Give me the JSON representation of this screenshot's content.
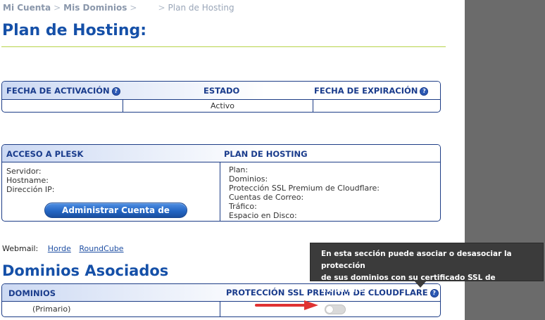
{
  "breadcrumb": {
    "item1": "Mi Cuenta",
    "item2": "Mis Dominios",
    "sep": ">",
    "current": "Plan de Hosting"
  },
  "page_title": "Plan de Hosting:",
  "status_table": {
    "headers": {
      "activation": "FECHA DE ACTIVACIÓN",
      "status": "ESTADO",
      "expiration": "FECHA DE EXPIRACIÓN"
    },
    "row": {
      "activation": "",
      "status": "Activo",
      "expiration": ""
    }
  },
  "plesk": {
    "header": "ACCESO A PLESK",
    "labels": [
      "Servidor:",
      "Hostname:",
      "Dirección IP:"
    ],
    "button": "Administrar Cuenta de Hosting"
  },
  "plan": {
    "header": "PLAN DE HOSTING",
    "labels": [
      "Plan:",
      "Dominios:",
      "Protección SSL Premium de Cloudflare:",
      "Cuentas de Correo:",
      "Tráfico:",
      "Espacio en Disco:"
    ]
  },
  "webmail": {
    "label": "Webmail:",
    "links": [
      "Horde",
      "RoundCube"
    ]
  },
  "domains_section": {
    "title": "Dominios Asociados",
    "headers": {
      "domains": "DOMINIOS",
      "ssl": "PROTECCIÓN SSL PREMIUM DE CLOUDFLARE"
    },
    "rows": [
      {
        "domain": "(Primario)",
        "ssl_enabled": false
      }
    ]
  },
  "tooltip": {
    "line1": "En esta sección puede asociar o desasociar la protección",
    "line2": "de sus dominios con su certificado SSL de Cloudflare."
  },
  "icons": {
    "help": "question-circle-icon",
    "arrow": "red-arrow-icon"
  },
  "colors": {
    "brand": "#1550a8",
    "border": "#1d3d86",
    "accent_line": "#b7d44a",
    "arrow": "#e03232"
  }
}
